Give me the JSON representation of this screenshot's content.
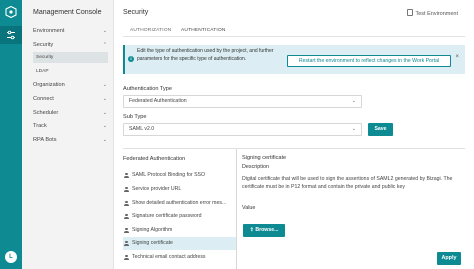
{
  "colors": {
    "accent": "#0e8a93",
    "info_bg": "#dceef3",
    "sidebar_bg": "#f3f3f3"
  },
  "rail": {
    "logo_icon": "bizagi-logo-icon",
    "tool_icon": "sliders-icon",
    "user_initial": "L"
  },
  "sidebar": {
    "title": "Management Console",
    "items": [
      {
        "label": "Environment",
        "expanded": false
      },
      {
        "label": "Security",
        "expanded": true,
        "children": [
          {
            "label": "Security",
            "active": true
          },
          {
            "label": "LDAP",
            "active": false
          }
        ]
      },
      {
        "label": "Organization",
        "expanded": false
      },
      {
        "label": "Connect",
        "expanded": false
      },
      {
        "label": "Scheduler",
        "expanded": false
      },
      {
        "label": "Track",
        "expanded": false
      },
      {
        "label": "RPA Bots",
        "expanded": false
      }
    ]
  },
  "header": {
    "title": "Security",
    "environment": "Test Environment"
  },
  "tabs": [
    {
      "label": "AUTHORIZATION",
      "active": false
    },
    {
      "label": "AUTHENTICATION",
      "active": true
    }
  ],
  "info": {
    "text": "Edit the type of authentication used by the project, and further parameters for the specific type of authentication.",
    "restart_label": "Restart the environment to reflect changes in the Work Portal",
    "close": "×"
  },
  "form": {
    "auth_type_label": "Authentication Type",
    "auth_type_value": "Federated Authentication",
    "sub_type_label": "Sub Type",
    "sub_type_value": "SAML v2.0",
    "save_label": "Save"
  },
  "federated": {
    "title": "Federated Authentication",
    "items": [
      {
        "label": "SAML Protocol Binding for SSO",
        "active": false
      },
      {
        "label": "Service provider URL",
        "active": false
      },
      {
        "label": "Show detailed authentication error mes...",
        "active": false
      },
      {
        "label": "Signature certificate password",
        "active": false
      },
      {
        "label": "Signing Algorithm",
        "active": false
      },
      {
        "label": "Signing certificate",
        "active": true
      },
      {
        "label": "Technical email contact address",
        "active": false
      }
    ]
  },
  "detail": {
    "title": "Signing certificate",
    "description_label": "Description",
    "description": "Digital certificate that will be used to sign the assertions of SAML2 generated by Bizagi. The certificate must be in P12 format and contain the private and public key",
    "value_label": "Value",
    "browse_label": "Browse...",
    "browse_icon": "upload-icon"
  },
  "apply_label": "Apply"
}
